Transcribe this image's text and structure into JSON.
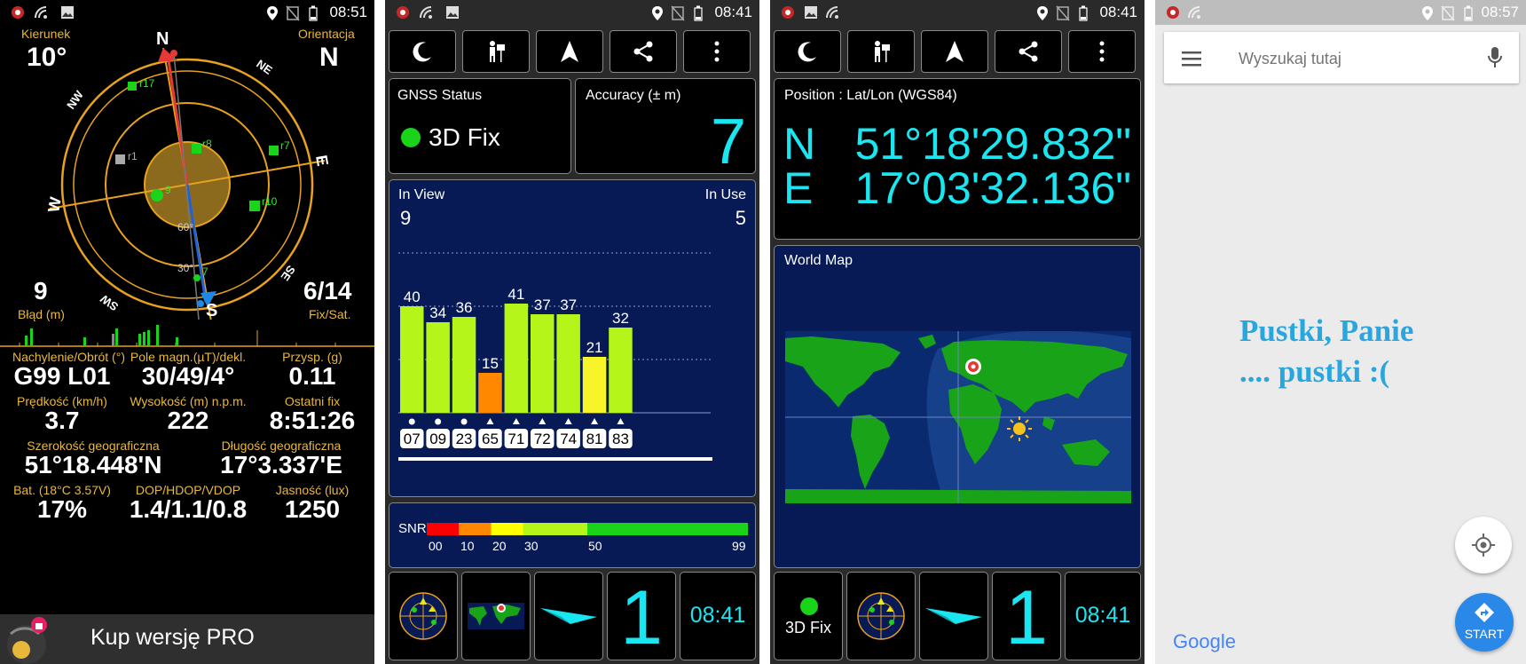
{
  "status_bars": [
    {
      "time": "08:51"
    },
    {
      "time": "08:41"
    },
    {
      "time": "08:41"
    },
    {
      "time": "08:57"
    }
  ],
  "compass_screen": {
    "heading_label": "Kierunek",
    "heading_value": "10°",
    "orientation_label": "Orientacja",
    "orientation_value": "N",
    "cardinals": {
      "n": "N",
      "ne": "NE",
      "e": "E",
      "se": "SE",
      "s": "S",
      "sw": "SW",
      "w": "W",
      "nw": "NW"
    },
    "ring_labels": {
      "r60": "60°",
      "r30": "30°"
    },
    "satellites": [
      "r17",
      "r1",
      "r8",
      "r7",
      "r10",
      "9",
      "7"
    ],
    "error_value": "9",
    "error_label": "Błąd (m)",
    "fix_value": "6/14",
    "fix_label": "Fix/Sat.",
    "stats": [
      {
        "label": "Nachylenie/Obrót (°)",
        "value": "G99 L01"
      },
      {
        "label": "Pole magn.(µT)/dekl.",
        "value": "30/49/4°"
      },
      {
        "label": "Przysp. (g)",
        "value": "0.11"
      },
      {
        "label": "Prędkość (km/h)",
        "value": "3.7"
      },
      {
        "label": "Wysokość (m) n.p.m.",
        "value": "222"
      },
      {
        "label": "Ostatni fix",
        "value": "8:51:26"
      },
      {
        "label": "Bat. (18°C 3.57V)",
        "value": "17%"
      },
      {
        "label": "DOP/HDOP/VDOP",
        "value": "1.4/1.1/0.8"
      },
      {
        "label": "Jasność (lux)",
        "value": "1250"
      }
    ],
    "lat_label": "Szerokość geograficzna",
    "lat_value": "51°18.448'N",
    "lon_label": "Długość geograficzna",
    "lon_value": "17°3.337'E",
    "pro_label": "Kup wersję PRO"
  },
  "gnss_screen": {
    "gnss_status_label": "GNSS Status",
    "fix_text": "3D Fix",
    "accuracy_label": "Accuracy (± m)",
    "accuracy_value": "7",
    "in_view_label": "In View",
    "in_view_value": "9",
    "in_use_label": "In Use",
    "in_use_value": "5",
    "snr_label": "SNR",
    "snr_ticks": [
      "00",
      "10",
      "20",
      "30",
      "50",
      "99"
    ],
    "bottom_number": "1",
    "bottom_time": "08:41"
  },
  "chart_data": {
    "type": "bar",
    "categories": [
      "07",
      "09",
      "23",
      "65",
      "71",
      "72",
      "74",
      "81",
      "83"
    ],
    "values": [
      40,
      34,
      36,
      15,
      41,
      37,
      37,
      21,
      32
    ],
    "bar_colors": [
      "#b6f51a",
      "#b6f51a",
      "#b6f51a",
      "#ff8800",
      "#b6f51a",
      "#b6f51a",
      "#b6f51a",
      "#f7f52a",
      "#b6f51a"
    ],
    "markers": [
      "circle",
      "circle",
      "circle",
      "triangle",
      "triangle",
      "triangle",
      "triangle",
      "triangle",
      "triangle"
    ],
    "ylim": [
      0,
      60
    ],
    "grid": true
  },
  "position_screen": {
    "position_label": "Position : Lat/Lon (WGS84)",
    "lat_hemi": "N",
    "lat": "51°18'29.832\"",
    "lon_hemi": "E",
    "lon": "17°03'32.136\"",
    "world_map_label": "World Map",
    "fix_text": "3D Fix",
    "bottom_number": "1",
    "bottom_time": "08:41"
  },
  "maps_screen": {
    "search_placeholder": "Wyszukaj tutaj",
    "line1": "Pustki, Panie",
    "line2": ".... pustki :(",
    "start_label": "START",
    "google_logo": "Google"
  },
  "colors": {
    "accent_yellow": "#e8b83b",
    "cyan": "#19e6f0",
    "panel_blue": "#071a55",
    "google_blue": "#2a88e8"
  }
}
